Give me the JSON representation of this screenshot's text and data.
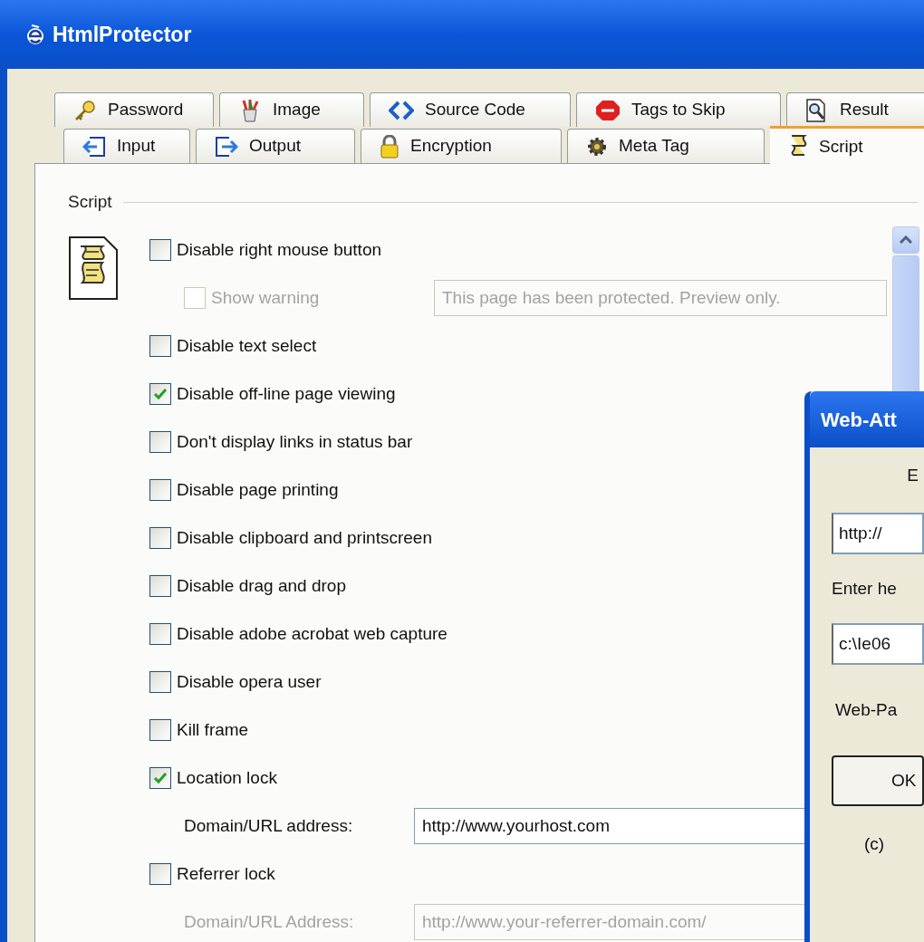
{
  "window": {
    "title": "HtmlProtector"
  },
  "tabs": {
    "row_1": [
      {
        "label": "Password",
        "selected": false
      },
      {
        "label": "Image",
        "selected": false
      },
      {
        "label": "Source Code",
        "selected": false
      },
      {
        "label": "Tags to Skip",
        "selected": false
      },
      {
        "label": "Result",
        "selected": false
      }
    ],
    "row_2": [
      {
        "label": "Input",
        "selected": false
      },
      {
        "label": "Output",
        "selected": false
      },
      {
        "label": "Encryption",
        "selected": false
      },
      {
        "label": "Meta Tag",
        "selected": false
      },
      {
        "label": "Script",
        "selected": true
      }
    ]
  },
  "group": {
    "title": "Script"
  },
  "options": [
    {
      "kind": "checkbox",
      "label": "Disable right mouse button",
      "checked": false,
      "disabled": false
    },
    {
      "kind": "checkbox-field",
      "label": "Show warning",
      "checked": false,
      "disabled": true,
      "value": "This page has been protected. Preview only."
    },
    {
      "kind": "checkbox",
      "label": "Disable text select",
      "checked": false,
      "disabled": false
    },
    {
      "kind": "checkbox",
      "label": "Disable off-line page viewing",
      "checked": true,
      "disabled": false
    },
    {
      "kind": "checkbox",
      "label": "Don't display links in status bar",
      "checked": false,
      "disabled": false
    },
    {
      "kind": "checkbox",
      "label": "Disable page printing",
      "checked": false,
      "disabled": false
    },
    {
      "kind": "checkbox",
      "label": "Disable clipboard and printscreen",
      "checked": false,
      "disabled": false
    },
    {
      "kind": "checkbox",
      "label": "Disable drag and drop",
      "checked": false,
      "disabled": false
    },
    {
      "kind": "checkbox",
      "label": "Disable adobe acrobat web capture",
      "checked": false,
      "disabled": false
    },
    {
      "kind": "checkbox",
      "label": "Disable opera user",
      "checked": false,
      "disabled": false
    },
    {
      "kind": "checkbox",
      "label": "Kill frame",
      "checked": false,
      "disabled": false
    },
    {
      "kind": "checkbox",
      "label": "Location lock",
      "checked": true,
      "disabled": false
    },
    {
      "kind": "field",
      "label": "Domain/URL address:",
      "value": "http://www.yourhost.com",
      "disabled": false
    },
    {
      "kind": "checkbox",
      "label": "Referrer lock",
      "checked": false,
      "disabled": false
    },
    {
      "kind": "field",
      "label": "Domain/URL Address:",
      "value": "http://www.your-referrer-domain.com/",
      "disabled": true
    }
  ],
  "dialog": {
    "title": "Web-Att",
    "heading": "E",
    "url_value": "http://",
    "prompt": "Enter he",
    "path_value": "c:\\Ie06",
    "label": "Web-Pa",
    "ok_button": "OK",
    "copyright": "(c)"
  }
}
